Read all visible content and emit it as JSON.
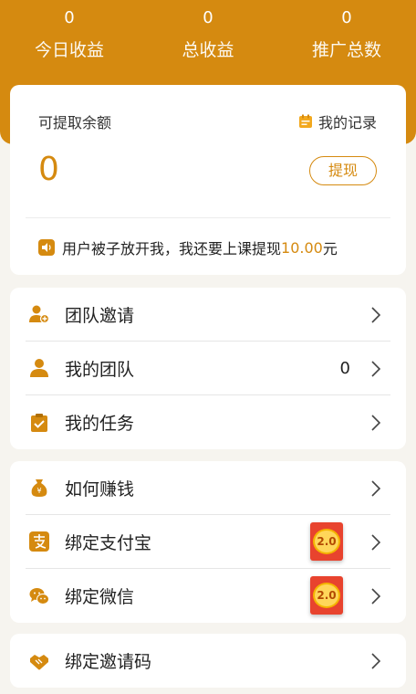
{
  "stats": [
    {
      "value": "0",
      "label": "今日收益"
    },
    {
      "value": "0",
      "label": "总收益"
    },
    {
      "value": "0",
      "label": "推广总数"
    }
  ],
  "balance": {
    "title": "可提取余额",
    "records_label": "我的记录",
    "amount": "0",
    "withdraw_label": "提现"
  },
  "notice": {
    "text": "用户被子放开我，我还要上课提现",
    "amount": "10.00",
    "unit": "元"
  },
  "menu_group1": [
    {
      "label": "团队邀请",
      "icon": "team-invite-icon"
    },
    {
      "label": "我的团队",
      "icon": "user-icon",
      "value": "0"
    },
    {
      "label": "我的任务",
      "icon": "task-icon"
    }
  ],
  "menu_group2": [
    {
      "label": "如何赚钱",
      "icon": "money-bag-icon"
    },
    {
      "label": "绑定支付宝",
      "icon": "alipay-icon",
      "badge": "2.0"
    },
    {
      "label": "绑定微信",
      "icon": "wechat-icon",
      "badge": "2.0"
    }
  ],
  "menu_group3": [
    {
      "label": "绑定邀请码",
      "icon": "handshake-icon"
    }
  ],
  "colors": {
    "accent": "#d58a10",
    "badge": "#e8432e"
  }
}
